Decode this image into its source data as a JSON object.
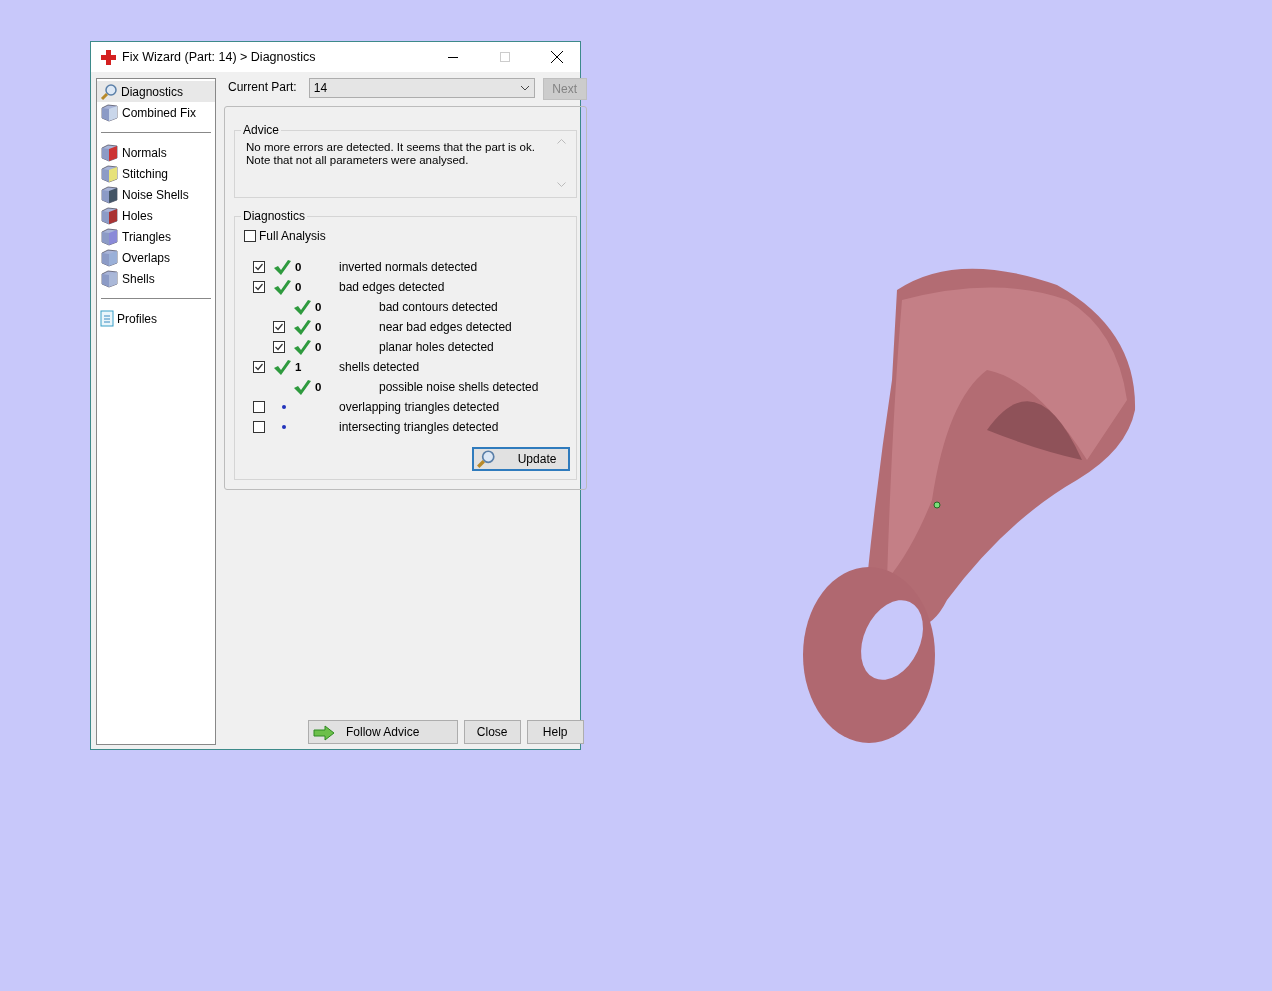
{
  "window": {
    "title": "Fix Wizard (Part: 14) > Diagnostics"
  },
  "sidebar": {
    "groups": [
      [
        {
          "label": "Diagnostics",
          "kind": "search",
          "selected": true
        },
        {
          "label": "Combined Fix",
          "kind": "combined",
          "selected": false
        }
      ],
      [
        {
          "label": "Normals",
          "kind": "normals",
          "selected": false
        },
        {
          "label": "Stitching",
          "kind": "stitching",
          "selected": false
        },
        {
          "label": "Noise Shells",
          "kind": "noise",
          "selected": false
        },
        {
          "label": "Holes",
          "kind": "holes",
          "selected": false
        },
        {
          "label": "Triangles",
          "kind": "triangles",
          "selected": false
        },
        {
          "label": "Overlaps",
          "kind": "overlaps",
          "selected": false
        },
        {
          "label": "Shells",
          "kind": "shells",
          "selected": false
        }
      ],
      [
        {
          "label": "Profiles",
          "kind": "profiles",
          "selected": false
        }
      ]
    ]
  },
  "current_part": {
    "label": "Current Part:",
    "value": "14",
    "next": "Next"
  },
  "advice": {
    "title": "Advice",
    "text": "No more errors are detected. It seems that the part is ok.\nNote that not all parameters were analysed."
  },
  "diagnostics": {
    "title": "Diagnostics",
    "full_analysis": {
      "label": "Full Analysis",
      "checked": false
    },
    "rows": [
      {
        "label": "inverted normals detected",
        "count": "0",
        "kind": "check",
        "checked": true
      },
      {
        "label": "bad edges detected",
        "count": "0",
        "kind": "check",
        "checked": true,
        "children": [
          {
            "label": "bad contours detected",
            "count": "0",
            "kind": "check"
          },
          {
            "label": "near bad edges detected",
            "count": "0",
            "kind": "check",
            "checked": true
          },
          {
            "label": "planar holes detected",
            "count": "0",
            "kind": "check",
            "checked": true
          }
        ]
      },
      {
        "label": "shells detected",
        "count": "1",
        "kind": "check",
        "checked": true,
        "children": [
          {
            "label": "possible noise shells detected",
            "count": "0",
            "kind": "check"
          }
        ]
      },
      {
        "label": "overlapping triangles detected",
        "kind": "dot",
        "checked": false
      },
      {
        "label": "intersecting triangles detected",
        "kind": "dot",
        "checked": false
      }
    ],
    "update": "Update"
  },
  "buttons": {
    "follow": "Follow Advice",
    "close": "Close",
    "help": "Help"
  }
}
